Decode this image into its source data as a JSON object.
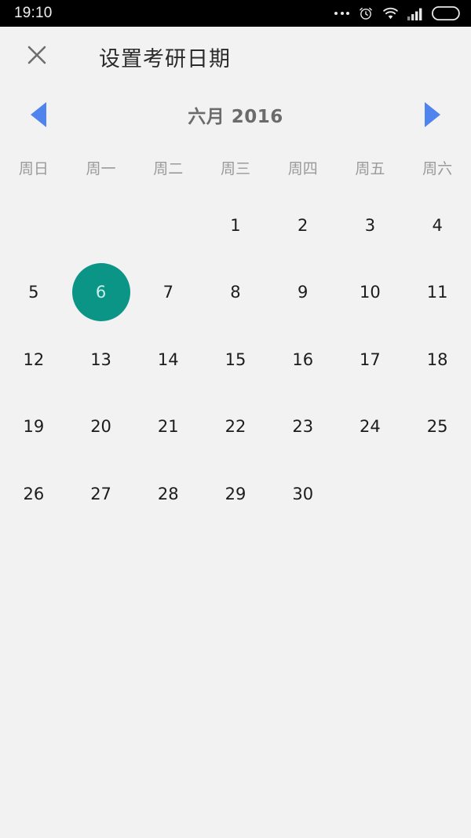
{
  "status_bar": {
    "time": "19:10",
    "icons": [
      "more-dots-icon",
      "alarm-clock-icon",
      "wifi-icon",
      "signal-bars-icon",
      "battery-icon"
    ]
  },
  "header": {
    "close_icon": "close-icon",
    "title": "设置考研日期"
  },
  "month_nav": {
    "prev_icon": "chevron-left-icon",
    "next_icon": "chevron-right-icon",
    "label": "六月 2016",
    "arrow_color": "#4f84ee"
  },
  "calendar": {
    "weekday_headers": [
      "周日",
      "周一",
      "周二",
      "周三",
      "周四",
      "周五",
      "周六"
    ],
    "selected_day": 6,
    "selected_color": "#0b9586",
    "weeks": [
      [
        "",
        "",
        "",
        "1",
        "2",
        "3",
        "4"
      ],
      [
        "5",
        "6",
        "7",
        "8",
        "9",
        "10",
        "11"
      ],
      [
        "12",
        "13",
        "14",
        "15",
        "16",
        "17",
        "18"
      ],
      [
        "19",
        "20",
        "21",
        "22",
        "23",
        "24",
        "25"
      ],
      [
        "26",
        "27",
        "28",
        "29",
        "30",
        "",
        ""
      ]
    ]
  }
}
